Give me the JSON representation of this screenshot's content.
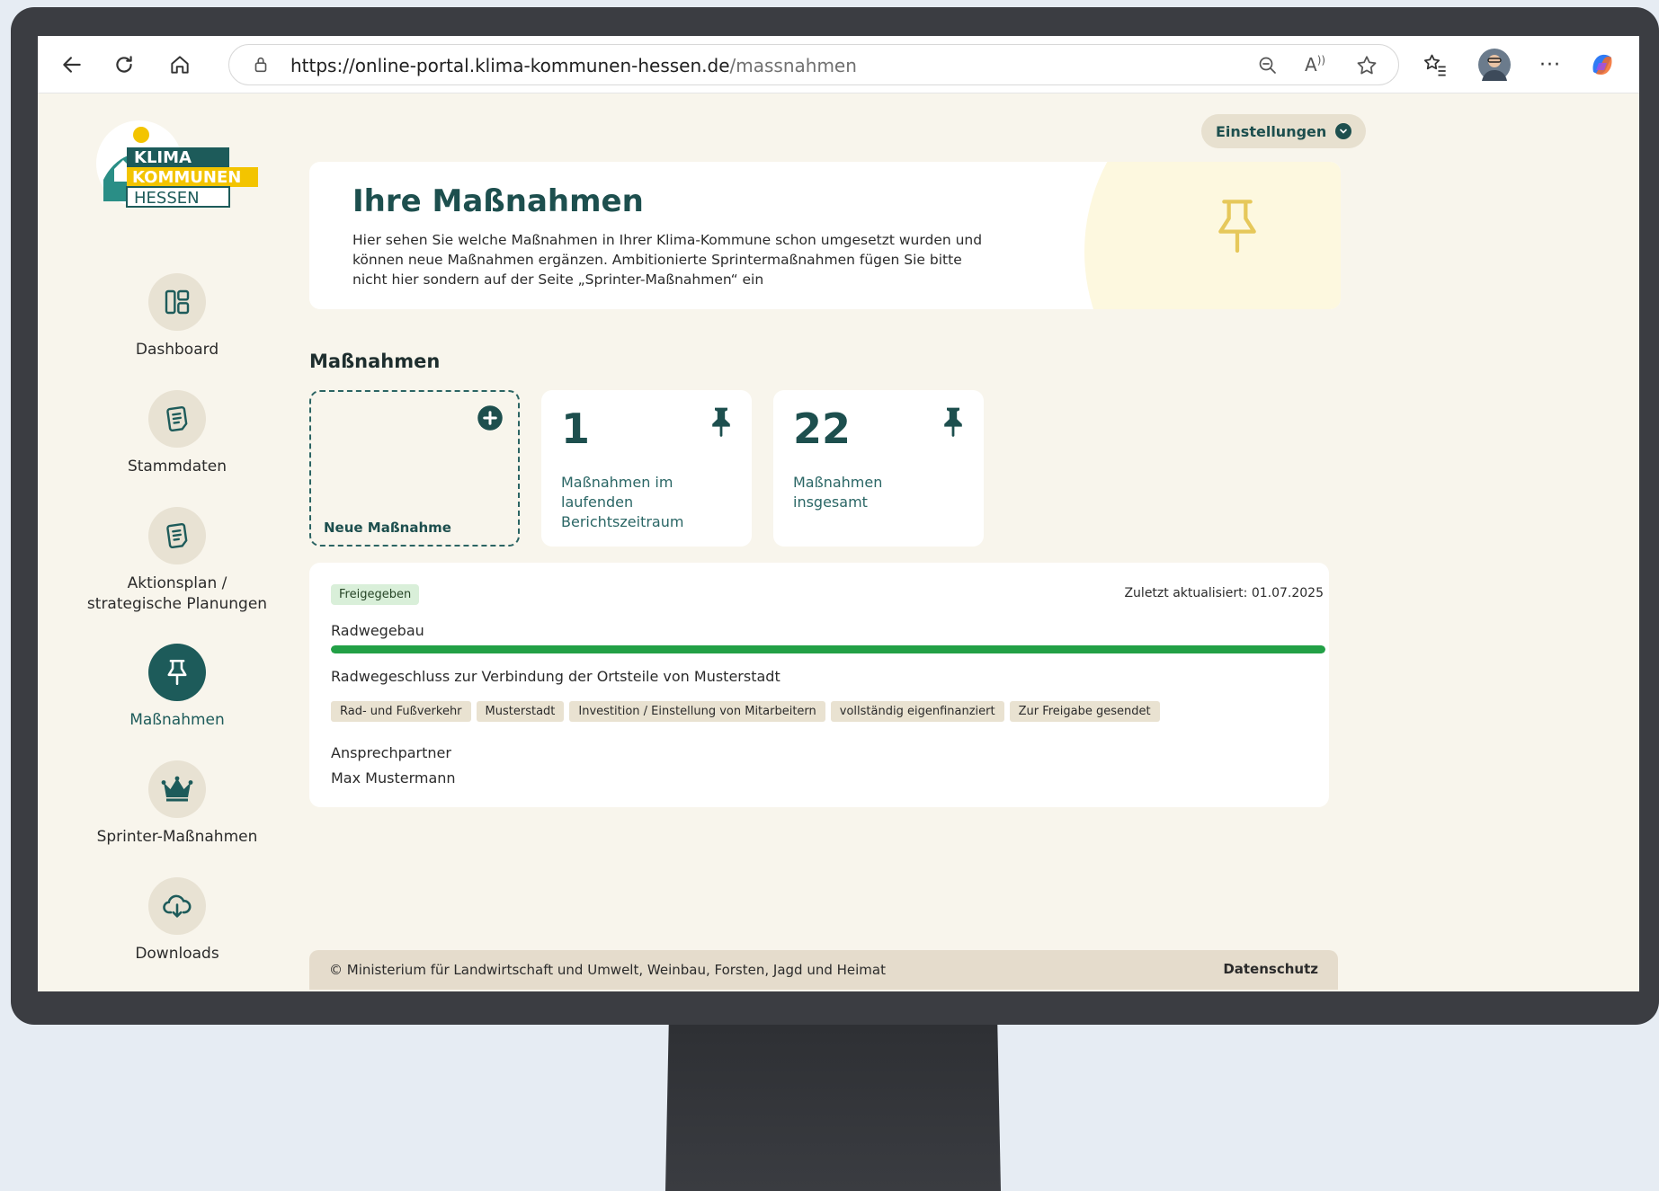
{
  "browser": {
    "url_host": "https://online-portal.klima-kommunen-hessen.de",
    "url_path": "/massnahmen"
  },
  "logo": {
    "line1": "KLIMA",
    "line2": "KOMMUNEN",
    "line3": "HESSEN"
  },
  "sidebar": {
    "items": [
      {
        "label": "Dashboard",
        "icon": "dashboard-icon"
      },
      {
        "label": "Stammdaten",
        "icon": "document-icon"
      },
      {
        "label": "Aktionsplan / strategische Planungen",
        "icon": "document-icon"
      },
      {
        "label": "Maßnahmen",
        "icon": "pin-icon",
        "active": true
      },
      {
        "label": "Sprinter-Maßnahmen",
        "icon": "crown-icon"
      },
      {
        "label": "Downloads",
        "icon": "cloud-download-icon"
      }
    ]
  },
  "header": {
    "settings_label": "Einstellungen"
  },
  "hero": {
    "title": "Ihre Maßnahmen",
    "text": "Hier sehen Sie welche Maßnahmen in Ihrer Klima-Kommune schon umgesetzt wurden und können neue Maßnahmen ergänzen. Ambitionierte Sprintermaßnahmen fügen Sie bitte nicht hier sondern auf der Seite „Sprinter-Maßnahmen“ ein"
  },
  "section": {
    "title": "Maßnahmen"
  },
  "cards": {
    "new_label": "Neue Maßnahme",
    "current": {
      "value": "1",
      "label": "Maßnahmen im laufenden Berichtszeitraum"
    },
    "total": {
      "value": "22",
      "label": "Maßnahmen insgesamt"
    }
  },
  "measure": {
    "status": "Freigegeben",
    "updated": "Zuletzt aktualisiert: 01.07.2025",
    "title": "Radwegebau",
    "progress": 1.0,
    "description": "Radwegeschluss zur Verbindung der Ortsteile von Musterstadt",
    "tags": [
      "Rad- und Fußverkehr",
      "Musterstadt",
      "Investition / Einstellung von Mitarbeitern",
      "vollständig eigenfinanziert",
      "Zur Freigabe gesendet"
    ],
    "contact_label": "Ansprechpartner",
    "contact_name": "Max Mustermann"
  },
  "footer": {
    "copyright": "© Ministerium für Landwirtschaft und Umwelt, Weinbau, Forsten, Jagd und Heimat",
    "privacy": "Datenschutz"
  },
  "colors": {
    "brand_dark": "#1d5b5a",
    "accent_yellow": "#f3c400",
    "progress_green": "#22a046"
  }
}
